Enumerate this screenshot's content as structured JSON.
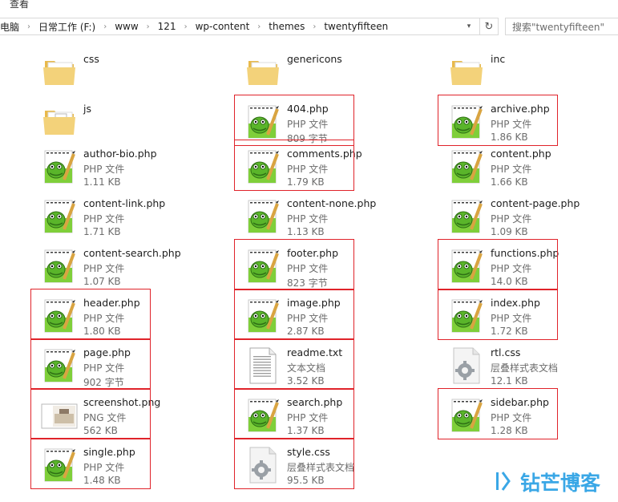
{
  "menu": {
    "view": "查看"
  },
  "address_bar": {
    "crumbs": [
      "电脑",
      "日常工作 (F:)",
      "www",
      "121",
      "wp-content",
      "themes",
      "twentyfifteen"
    ],
    "separator": "›",
    "dropdown_glyph": "▾",
    "refresh_glyph": "↻"
  },
  "search": {
    "placeholder": "搜索\"twentyfifteen\""
  },
  "files": [
    {
      "name": "css",
      "kind": "folder",
      "type": "",
      "size": "",
      "highlighted": false
    },
    {
      "name": "genericons",
      "kind": "folder",
      "type": "",
      "size": "",
      "highlighted": false
    },
    {
      "name": "inc",
      "kind": "folder-app",
      "type": "",
      "size": "",
      "highlighted": false
    },
    {
      "name": "js",
      "kind": "folder-js",
      "type": "",
      "size": "",
      "highlighted": false
    },
    {
      "name": "404.php",
      "kind": "php",
      "type": "PHP 文件",
      "size": "809 字节",
      "highlighted": true
    },
    {
      "name": "archive.php",
      "kind": "php",
      "type": "PHP 文件",
      "size": "1.86 KB",
      "highlighted": true
    },
    {
      "name": "author-bio.php",
      "kind": "php",
      "type": "PHP 文件",
      "size": "1.11 KB",
      "highlighted": false
    },
    {
      "name": "comments.php",
      "kind": "php",
      "type": "PHP 文件",
      "size": "1.79 KB",
      "highlighted": true
    },
    {
      "name": "content.php",
      "kind": "php",
      "type": "PHP 文件",
      "size": "1.66 KB",
      "highlighted": false
    },
    {
      "name": "content-link.php",
      "kind": "php",
      "type": "PHP 文件",
      "size": "1.71 KB",
      "highlighted": false
    },
    {
      "name": "content-none.php",
      "kind": "php",
      "type": "PHP 文件",
      "size": "1.13 KB",
      "highlighted": false
    },
    {
      "name": "content-page.php",
      "kind": "php",
      "type": "PHP 文件",
      "size": "1.09 KB",
      "highlighted": false
    },
    {
      "name": "content-search.php",
      "kind": "php",
      "type": "PHP 文件",
      "size": "1.07 KB",
      "highlighted": false
    },
    {
      "name": "footer.php",
      "kind": "php",
      "type": "PHP 文件",
      "size": "823 字节",
      "highlighted": true
    },
    {
      "name": "functions.php",
      "kind": "php",
      "type": "PHP 文件",
      "size": "14.0 KB",
      "highlighted": true
    },
    {
      "name": "header.php",
      "kind": "php",
      "type": "PHP 文件",
      "size": "1.80 KB",
      "highlighted": true
    },
    {
      "name": "image.php",
      "kind": "php",
      "type": "PHP 文件",
      "size": "2.87 KB",
      "highlighted": true
    },
    {
      "name": "index.php",
      "kind": "php",
      "type": "PHP 文件",
      "size": "1.72 KB",
      "highlighted": true
    },
    {
      "name": "page.php",
      "kind": "php",
      "type": "PHP 文件",
      "size": "902 字节",
      "highlighted": true
    },
    {
      "name": "readme.txt",
      "kind": "txt",
      "type": "文本文档",
      "size": "3.52 KB",
      "highlighted": true
    },
    {
      "name": "rtl.css",
      "kind": "css",
      "type": "层叠样式表文档",
      "size": "12.1 KB",
      "highlighted": false
    },
    {
      "name": "screenshot.png",
      "kind": "png",
      "type": "PNG 文件",
      "size": "562 KB",
      "highlighted": true
    },
    {
      "name": "search.php",
      "kind": "php",
      "type": "PHP 文件",
      "size": "1.37 KB",
      "highlighted": true
    },
    {
      "name": "sidebar.php",
      "kind": "php",
      "type": "PHP 文件",
      "size": "1.28 KB",
      "highlighted": true
    },
    {
      "name": "single.php",
      "kind": "php",
      "type": "PHP 文件",
      "size": "1.48 KB",
      "highlighted": true
    },
    {
      "name": "style.css",
      "kind": "css",
      "type": "层叠样式表文档",
      "size": "95.5 KB",
      "highlighted": true
    }
  ],
  "watermark": {
    "text": "钻芒博客"
  },
  "colors": {
    "highlight_border": "#e0232a",
    "folder": "#f3d27a",
    "watermark": "#3aa7e6"
  }
}
